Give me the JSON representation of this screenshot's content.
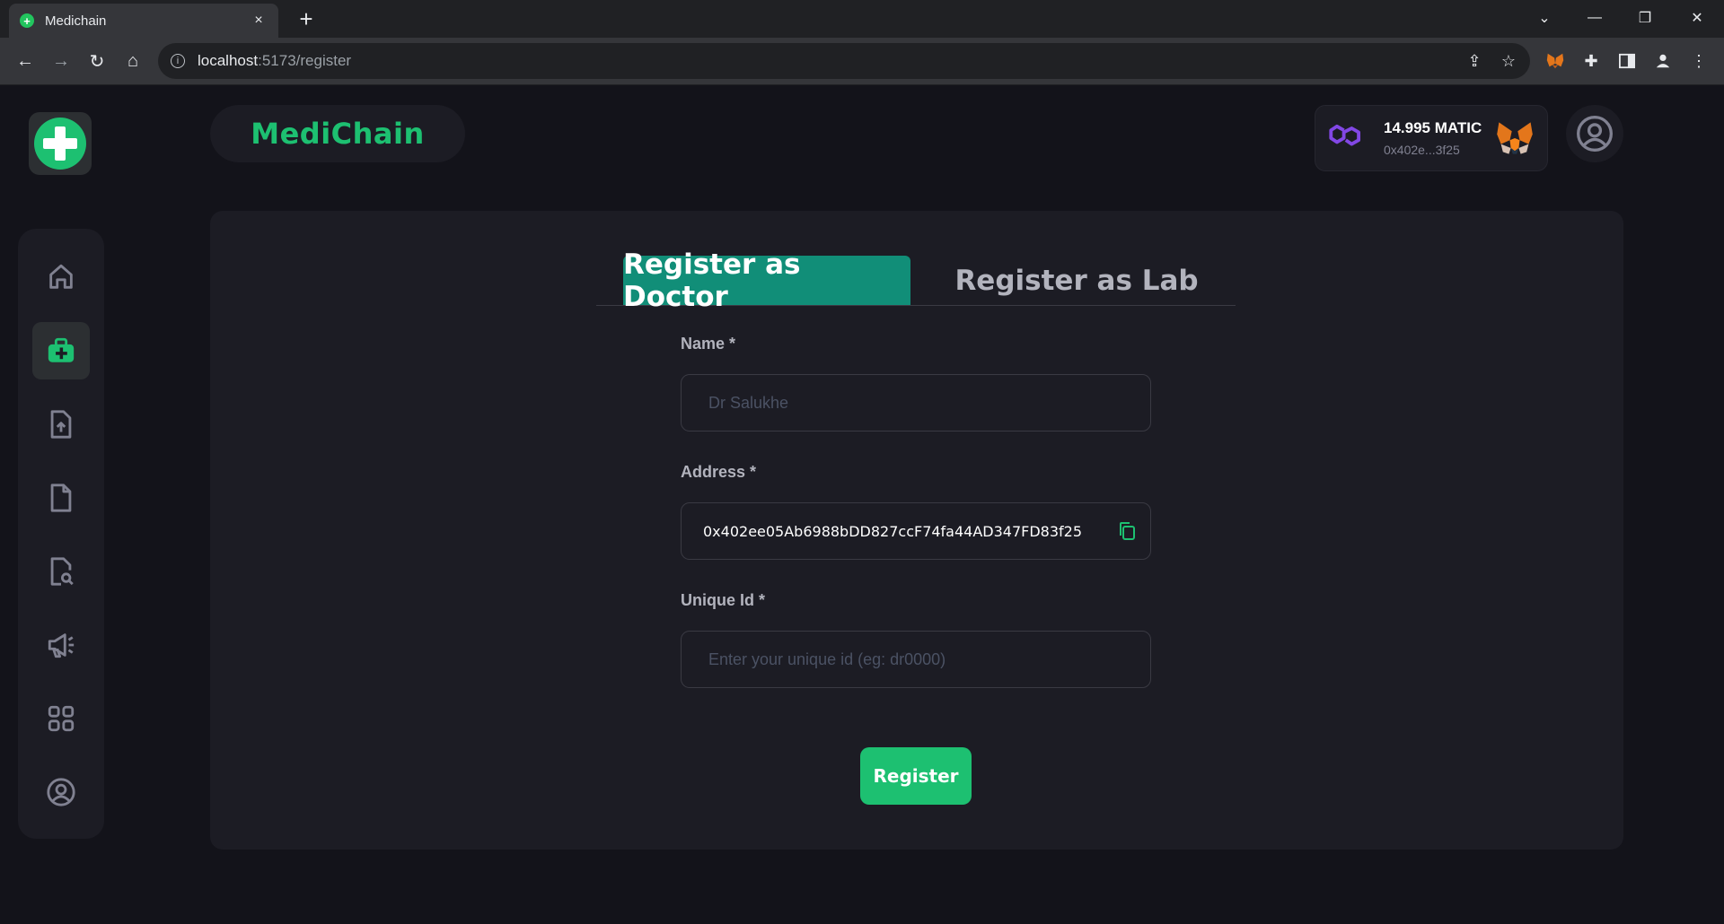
{
  "browser": {
    "tab_title": "Medichain",
    "tab_close": "×",
    "new_tab": "+",
    "url_host": "localhost",
    "url_rest": ":5173/register"
  },
  "app": {
    "brand": "MediChain",
    "wallet": {
      "balance": "14.995 MATIC",
      "address": "0x402e...3f25"
    },
    "sidebar": {
      "items": [
        {
          "name": "home"
        },
        {
          "name": "doctor-kit",
          "active": true
        },
        {
          "name": "upload-file"
        },
        {
          "name": "file"
        },
        {
          "name": "file-search"
        },
        {
          "name": "megaphone"
        },
        {
          "name": "grid"
        },
        {
          "name": "profile"
        }
      ]
    },
    "register": {
      "tabs": [
        {
          "label": "Register as Doctor",
          "active": true
        },
        {
          "label": "Register as Lab",
          "active": false
        }
      ],
      "fields": {
        "name_label": "Name *",
        "name_placeholder": "Dr Salukhe",
        "address_label": "Address *",
        "address_value": "0x402ee05Ab6988bDD827ccF74fa44AD347FD83f25",
        "uid_label": "Unique Id *",
        "uid_placeholder": "Enter your unique id (eg: dr0000)"
      },
      "submit_label": "Register"
    }
  },
  "colors": {
    "accent": "#1dc071",
    "tab_active": "#118e78",
    "panel": "#1c1c24",
    "background": "#13131a"
  }
}
